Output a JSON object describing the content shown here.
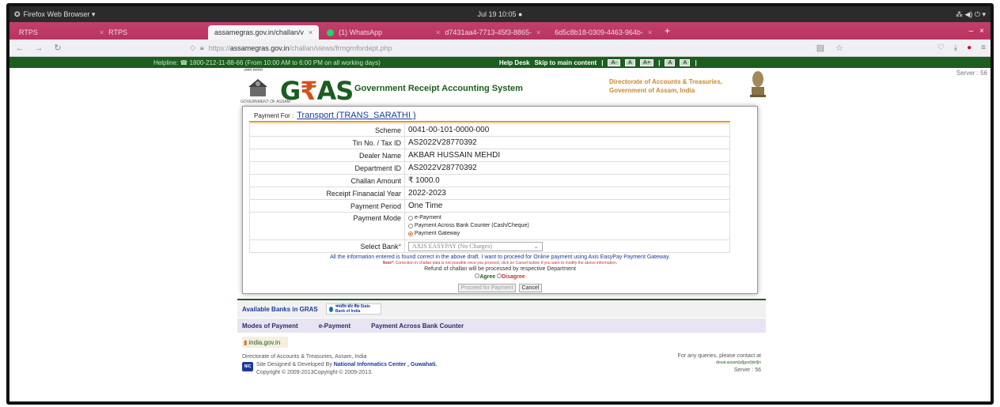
{
  "os": {
    "app_label": "Firefox Web Browser ▾",
    "clock": "Jul 19  10:05 ●",
    "tray": "⁂  ◀)  ⏻ ▾"
  },
  "tabs": [
    {
      "label": "RTPS",
      "active": false
    },
    {
      "label": "RTPS",
      "active": false
    },
    {
      "label": "assamegras.gov.in/challan/v",
      "active": true
    },
    {
      "label": "(1) WhatsApp",
      "active": false
    },
    {
      "label": "d7431aa4-7713-45f3-8865-",
      "active": false
    },
    {
      "label": "6d5c8b18-0309-4463-964b-",
      "active": false
    }
  ],
  "nav": {
    "url_prefix": "https://",
    "url_domain": "assamegras.gov.in",
    "url_path": "/challan/views/frmgrnfordept.php"
  },
  "helpline": {
    "text": "Helpline: ☎ 1800-212-11-88-66 (From 10:00 AM to 6:00 PM on all working days)",
    "help_desk": "Help Desk",
    "skip": "Skip to main content",
    "size_buttons": [
      "A-",
      "A",
      "A+"
    ],
    "contrast_buttons": [
      "A",
      "A"
    ]
  },
  "server_top": "Server : 56",
  "header": {
    "govt_top": "असम सरकार",
    "govt_bottom": "GOVERNMENT OF ASSAM",
    "logo_g": "G",
    "logo_r": "₹",
    "logo_as": "AS",
    "subtitle": "Government Receipt Accounting System",
    "directorate_line1": "Directorate of Accounts & Treasuries,",
    "directorate_line2": "Government of Assam, India"
  },
  "form": {
    "payment_for_label": "Payment For :",
    "payment_for_value": "Transport (TRANS_SARATHI )",
    "rows": [
      {
        "label": "Scheme",
        "value": "0041-00-101-0000-000"
      },
      {
        "label": "Tin No. / Tax ID",
        "value": "AS2022V28770392"
      },
      {
        "label": "Dealer Name",
        "value": "AKBAR HUSSAIN MEHDI"
      },
      {
        "label": "Department ID",
        "value": "AS2022V28770392"
      },
      {
        "label": "Challan Amount",
        "value": "₹ 1000.0"
      },
      {
        "label": "Receipt Finanacial Year",
        "value": "2022-2023"
      },
      {
        "label": "Payment Period",
        "value": "One Time"
      }
    ],
    "payment_mode_label": "Payment Mode",
    "payment_modes": [
      "e-Payment",
      "Payment Across Bank Counter (Cash/Cheque)",
      "Payment Gateway"
    ],
    "selected_mode": "Payment Gateway",
    "select_bank_label": "Select Bank",
    "select_bank_required": "*",
    "select_bank_value": "AXIS EASYPAY (No Charges)",
    "info": "All the information entered is found correct in the above draft. I want to proceed for Online payment using Axis EasyPay Payment Gateway.",
    "note_label": "Note*",
    "note": ": Correction in challan data is not possible once you proceed, click on Cancel button if you want to modify the above information.",
    "refund": "Refund of challan will be processed by respective Department",
    "agree": "Agree",
    "disagree": "Disagree",
    "proceed_button": "Proceed for Payment",
    "cancel_button": "Cancel"
  },
  "banks": {
    "label": "Available Banks in GRAS",
    "sbi_name": "भारतीय स्टेट बैंक State Bank of India"
  },
  "modes": {
    "label": "Modes of Payment",
    "items": [
      "e-Payment",
      "Payment Across Bank Counter"
    ]
  },
  "footer": {
    "indiagov": "india.gov.in",
    "nic_logo": "NIC",
    "line1": "Directorate of Accounts & Treasuries, Assam, India",
    "line2_prefix": "Site Designed & Developed By",
    "line2_bold": "National Informatics Center , Guwahati.",
    "line3": "Copyright © 2009-2013Copyright © 2009-2013.",
    "queries": "For any queries, please contact at",
    "email": "dosat.assam[at]gov[dot]in",
    "server": "Server : 56"
  }
}
